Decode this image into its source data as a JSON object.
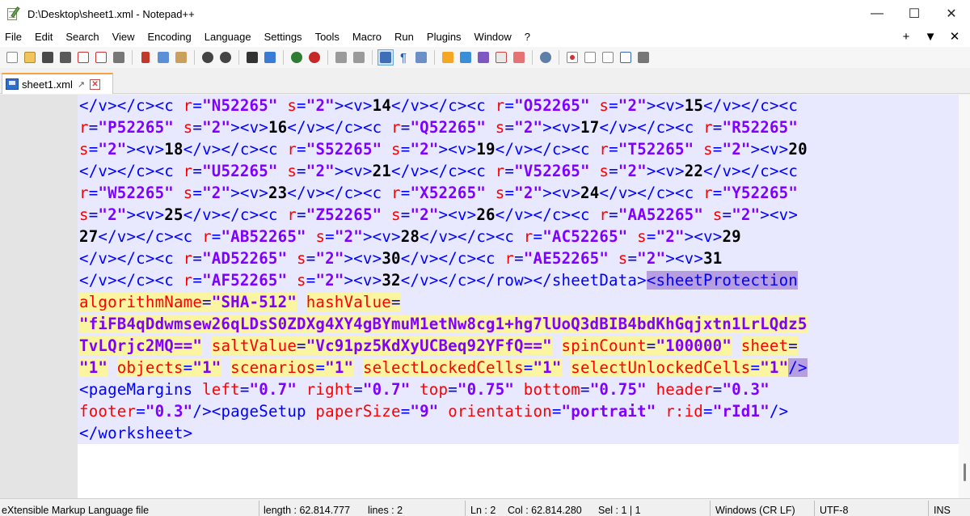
{
  "window": {
    "title": "D:\\Desktop\\sheet1.xml - Notepad++",
    "minimize": "—",
    "maximize": "☐",
    "close": "✕"
  },
  "menu": {
    "items": [
      "File",
      "Edit",
      "Search",
      "View",
      "Encoding",
      "Language",
      "Settings",
      "Tools",
      "Macro",
      "Run",
      "Plugins",
      "Window",
      "?"
    ],
    "right": [
      "+",
      "▼",
      "✕"
    ]
  },
  "tab": {
    "label": "sheet1.xml",
    "pin": "📌",
    "close": "✕"
  },
  "status": {
    "language": "eXtensible Markup Language file",
    "length": "length : 62.814.777",
    "lines": "lines : 2",
    "ln": "Ln : 2",
    "col": "Col : 62.814.280",
    "sel": "Sel : 1 | 1",
    "eol": "Windows (CR LF)",
    "encoding": "UTF-8",
    "mode": "INS"
  },
  "code": {
    "lines": [
      [
        [
          "t",
          "</v></c><c "
        ],
        [
          "a",
          "r"
        ],
        [
          "t",
          "="
        ],
        [
          "v",
          "\"N52265\""
        ],
        [
          "t",
          " "
        ],
        [
          "a",
          "s"
        ],
        [
          "t",
          "="
        ],
        [
          "v",
          "\"2\""
        ],
        [
          "t",
          "><v>"
        ],
        [
          "x",
          "14"
        ],
        [
          "t",
          "</v></c><c "
        ],
        [
          "a",
          "r"
        ],
        [
          "t",
          "="
        ],
        [
          "v",
          "\"O52265\""
        ],
        [
          "t",
          " "
        ],
        [
          "a",
          "s"
        ],
        [
          "t",
          "="
        ],
        [
          "v",
          "\"2\""
        ],
        [
          "t",
          "><v>"
        ],
        [
          "x",
          "15"
        ],
        [
          "t",
          "</v></c><c"
        ]
      ],
      [
        [
          "a",
          "r"
        ],
        [
          "t",
          "="
        ],
        [
          "v",
          "\"P52265\""
        ],
        [
          "t",
          " "
        ],
        [
          "a",
          "s"
        ],
        [
          "t",
          "="
        ],
        [
          "v",
          "\"2\""
        ],
        [
          "t",
          "><v>"
        ],
        [
          "x",
          "16"
        ],
        [
          "t",
          "</v></c><c "
        ],
        [
          "a",
          "r"
        ],
        [
          "t",
          "="
        ],
        [
          "v",
          "\"Q52265\""
        ],
        [
          "t",
          " "
        ],
        [
          "a",
          "s"
        ],
        [
          "t",
          "="
        ],
        [
          "v",
          "\"2\""
        ],
        [
          "t",
          "><v>"
        ],
        [
          "x",
          "17"
        ],
        [
          "t",
          "</v></c><c "
        ],
        [
          "a",
          "r"
        ],
        [
          "t",
          "="
        ],
        [
          "v",
          "\"R52265\""
        ]
      ],
      [
        [
          "a",
          "s"
        ],
        [
          "t",
          "="
        ],
        [
          "v",
          "\"2\""
        ],
        [
          "t",
          "><v>"
        ],
        [
          "x",
          "18"
        ],
        [
          "t",
          "</v></c><c "
        ],
        [
          "a",
          "r"
        ],
        [
          "t",
          "="
        ],
        [
          "v",
          "\"S52265\""
        ],
        [
          "t",
          " "
        ],
        [
          "a",
          "s"
        ],
        [
          "t",
          "="
        ],
        [
          "v",
          "\"2\""
        ],
        [
          "t",
          "><v>"
        ],
        [
          "x",
          "19"
        ],
        [
          "t",
          "</v></c><c "
        ],
        [
          "a",
          "r"
        ],
        [
          "t",
          "="
        ],
        [
          "v",
          "\"T52265\""
        ],
        [
          "t",
          " "
        ],
        [
          "a",
          "s"
        ],
        [
          "t",
          "="
        ],
        [
          "v",
          "\"2\""
        ],
        [
          "t",
          "><v>"
        ],
        [
          "x",
          "20"
        ]
      ],
      [
        [
          "t",
          "</v></c><c "
        ],
        [
          "a",
          "r"
        ],
        [
          "t",
          "="
        ],
        [
          "v",
          "\"U52265\""
        ],
        [
          "t",
          " "
        ],
        [
          "a",
          "s"
        ],
        [
          "t",
          "="
        ],
        [
          "v",
          "\"2\""
        ],
        [
          "t",
          "><v>"
        ],
        [
          "x",
          "21"
        ],
        [
          "t",
          "</v></c><c "
        ],
        [
          "a",
          "r"
        ],
        [
          "t",
          "="
        ],
        [
          "v",
          "\"V52265\""
        ],
        [
          "t",
          " "
        ],
        [
          "a",
          "s"
        ],
        [
          "t",
          "="
        ],
        [
          "v",
          "\"2\""
        ],
        [
          "t",
          "><v>"
        ],
        [
          "x",
          "22"
        ],
        [
          "t",
          "</v></c><c"
        ]
      ],
      [
        [
          "a",
          "r"
        ],
        [
          "t",
          "="
        ],
        [
          "v",
          "\"W52265\""
        ],
        [
          "t",
          " "
        ],
        [
          "a",
          "s"
        ],
        [
          "t",
          "="
        ],
        [
          "v",
          "\"2\""
        ],
        [
          "t",
          "><v>"
        ],
        [
          "x",
          "23"
        ],
        [
          "t",
          "</v></c><c "
        ],
        [
          "a",
          "r"
        ],
        [
          "t",
          "="
        ],
        [
          "v",
          "\"X52265\""
        ],
        [
          "t",
          " "
        ],
        [
          "a",
          "s"
        ],
        [
          "t",
          "="
        ],
        [
          "v",
          "\"2\""
        ],
        [
          "t",
          "><v>"
        ],
        [
          "x",
          "24"
        ],
        [
          "t",
          "</v></c><c "
        ],
        [
          "a",
          "r"
        ],
        [
          "t",
          "="
        ],
        [
          "v",
          "\"Y52265\""
        ]
      ],
      [
        [
          "a",
          "s"
        ],
        [
          "t",
          "="
        ],
        [
          "v",
          "\"2\""
        ],
        [
          "t",
          "><v>"
        ],
        [
          "x",
          "25"
        ],
        [
          "t",
          "</v></c><c "
        ],
        [
          "a",
          "r"
        ],
        [
          "t",
          "="
        ],
        [
          "v",
          "\"Z52265\""
        ],
        [
          "t",
          " "
        ],
        [
          "a",
          "s"
        ],
        [
          "t",
          "="
        ],
        [
          "v",
          "\"2\""
        ],
        [
          "t",
          "><v>"
        ],
        [
          "x",
          "26"
        ],
        [
          "t",
          "</v></c><c "
        ],
        [
          "a",
          "r"
        ],
        [
          "t",
          "="
        ],
        [
          "v",
          "\"AA52265\""
        ],
        [
          "t",
          " "
        ],
        [
          "a",
          "s"
        ],
        [
          "t",
          "="
        ],
        [
          "v",
          "\"2\""
        ],
        [
          "t",
          "><v>"
        ]
      ],
      [
        [
          "x",
          "27"
        ],
        [
          "t",
          "</v></c><c "
        ],
        [
          "a",
          "r"
        ],
        [
          "t",
          "="
        ],
        [
          "v",
          "\"AB52265\""
        ],
        [
          "t",
          " "
        ],
        [
          "a",
          "s"
        ],
        [
          "t",
          "="
        ],
        [
          "v",
          "\"2\""
        ],
        [
          "t",
          "><v>"
        ],
        [
          "x",
          "28"
        ],
        [
          "t",
          "</v></c><c "
        ],
        [
          "a",
          "r"
        ],
        [
          "t",
          "="
        ],
        [
          "v",
          "\"AC52265\""
        ],
        [
          "t",
          " "
        ],
        [
          "a",
          "s"
        ],
        [
          "t",
          "="
        ],
        [
          "v",
          "\"2\""
        ],
        [
          "t",
          "><v>"
        ],
        [
          "x",
          "29"
        ]
      ],
      [
        [
          "t",
          "</v></c><c "
        ],
        [
          "a",
          "r"
        ],
        [
          "t",
          "="
        ],
        [
          "v",
          "\"AD52265\""
        ],
        [
          "t",
          " "
        ],
        [
          "a",
          "s"
        ],
        [
          "t",
          "="
        ],
        [
          "v",
          "\"2\""
        ],
        [
          "t",
          "><v>"
        ],
        [
          "x",
          "30"
        ],
        [
          "t",
          "</v></c><c "
        ],
        [
          "a",
          "r"
        ],
        [
          "t",
          "="
        ],
        [
          "v",
          "\"AE52265\""
        ],
        [
          "t",
          " "
        ],
        [
          "a",
          "s"
        ],
        [
          "t",
          "="
        ],
        [
          "v",
          "\"2\""
        ],
        [
          "t",
          "><v>"
        ],
        [
          "x",
          "31"
        ]
      ],
      [
        [
          "t",
          "</v></c><c "
        ],
        [
          "a",
          "r"
        ],
        [
          "t",
          "="
        ],
        [
          "v",
          "\"AF52265\""
        ],
        [
          "t",
          " "
        ],
        [
          "a",
          "s"
        ],
        [
          "t",
          "="
        ],
        [
          "v",
          "\"2\""
        ],
        [
          "t",
          "><v>"
        ],
        [
          "x",
          "32"
        ],
        [
          "t",
          "</v></c></row></sheetData>"
        ],
        [
          "t sel",
          "<sheetProtection"
        ]
      ],
      [
        [
          "a hl",
          "algorithmName"
        ],
        [
          "t hl",
          "="
        ],
        [
          "v hl",
          "\"SHA-512\""
        ],
        [
          "t",
          " "
        ],
        [
          "a hl",
          "hashValue"
        ],
        [
          "t hl",
          "="
        ]
      ],
      [
        [
          "v hl",
          "\"fiFB4qDdwmsew26qLDsS0ZDXg4XY4gBYmuM1etNw8cg1+hg7lUoQ3dBIB4bdKhGqjxtn1LrLQdz5"
        ]
      ],
      [
        [
          "v hl",
          "TvLQrjc2MQ==\""
        ],
        [
          "t",
          " "
        ],
        [
          "a hl",
          "saltValue"
        ],
        [
          "t hl",
          "="
        ],
        [
          "v hl",
          "\"Vc91pz5KdXyUCBeq92YFfQ==\""
        ],
        [
          "t",
          " "
        ],
        [
          "a hl",
          "spinCount"
        ],
        [
          "t hl",
          "="
        ],
        [
          "v hl",
          "\"100000\""
        ],
        [
          "t",
          " "
        ],
        [
          "a hl",
          "sheet"
        ],
        [
          "t hl",
          "="
        ]
      ],
      [
        [
          "v hl",
          "\"1\""
        ],
        [
          "t",
          " "
        ],
        [
          "a hl",
          "objects"
        ],
        [
          "t hl",
          "="
        ],
        [
          "v hl",
          "\"1\""
        ],
        [
          "t",
          " "
        ],
        [
          "a hl",
          "scenarios"
        ],
        [
          "t hl",
          "="
        ],
        [
          "v hl",
          "\"1\""
        ],
        [
          "t",
          " "
        ],
        [
          "a hl",
          "selectLockedCells"
        ],
        [
          "t hl",
          "="
        ],
        [
          "v hl",
          "\"1\""
        ],
        [
          "t",
          " "
        ],
        [
          "a hl",
          "selectUnlockedCells"
        ],
        [
          "t hl",
          "="
        ],
        [
          "v hl",
          "\"1\""
        ],
        [
          "t sel",
          "/>"
        ]
      ],
      [
        [
          "t",
          "<pageMargins "
        ],
        [
          "a",
          "left"
        ],
        [
          "t",
          "="
        ],
        [
          "v",
          "\"0.7\""
        ],
        [
          "t",
          " "
        ],
        [
          "a",
          "right"
        ],
        [
          "t",
          "="
        ],
        [
          "v",
          "\"0.7\""
        ],
        [
          "t",
          " "
        ],
        [
          "a",
          "top"
        ],
        [
          "t",
          "="
        ],
        [
          "v",
          "\"0.75\""
        ],
        [
          "t",
          " "
        ],
        [
          "a",
          "bottom"
        ],
        [
          "t",
          "="
        ],
        [
          "v",
          "\"0.75\""
        ],
        [
          "t",
          " "
        ],
        [
          "a",
          "header"
        ],
        [
          "t",
          "="
        ],
        [
          "v",
          "\"0.3\""
        ]
      ],
      [
        [
          "a",
          "footer"
        ],
        [
          "t",
          "="
        ],
        [
          "v",
          "\"0.3\""
        ],
        [
          "t",
          "/><pageSetup "
        ],
        [
          "a",
          "paperSize"
        ],
        [
          "t",
          "="
        ],
        [
          "v",
          "\"9\""
        ],
        [
          "t",
          " "
        ],
        [
          "a",
          "orientation"
        ],
        [
          "t",
          "="
        ],
        [
          "v",
          "\"portrait\""
        ],
        [
          "t",
          " "
        ],
        [
          "a",
          "r:id"
        ],
        [
          "t",
          "="
        ],
        [
          "v",
          "\"rId1\""
        ],
        [
          "t",
          "/>"
        ]
      ],
      [
        [
          "t",
          "</worksheet>"
        ]
      ]
    ]
  }
}
